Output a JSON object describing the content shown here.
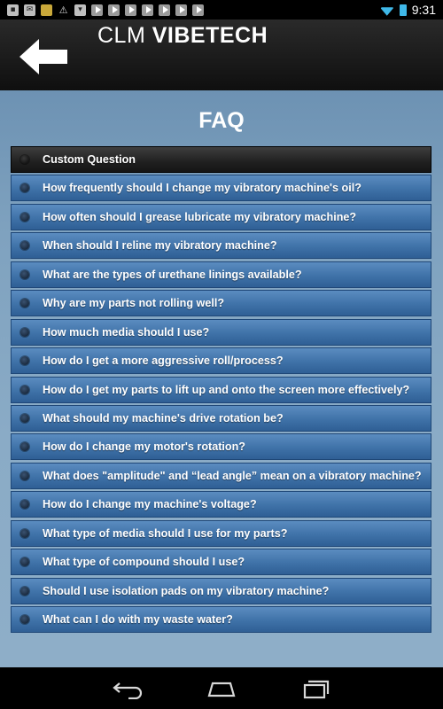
{
  "status_bar": {
    "time": "9:31",
    "icons": [
      "notification-icon",
      "mail-icon",
      "image-icon",
      "warning-icon",
      "download-icon",
      "media-icon",
      "media-icon",
      "media-icon",
      "media-icon",
      "media-icon",
      "media-icon",
      "media-icon"
    ],
    "accent_color": "#3fb8e8"
  },
  "header": {
    "title_prefix": "CLM",
    "title_bold": "VIBETECH",
    "back_icon": "back-arrow-icon"
  },
  "main": {
    "page_title": "FAQ",
    "items": [
      {
        "label": "Custom Question"
      },
      {
        "label": "How frequently should I change my vibratory machine's oil?"
      },
      {
        "label": "How often should I grease lubricate my vibratory machine?"
      },
      {
        "label": "When should I reline my vibratory machine?"
      },
      {
        "label": "What are the types of urethane linings available?"
      },
      {
        "label": "Why are my parts not rolling well?"
      },
      {
        "label": "How much media should I use?"
      },
      {
        "label": "How do I get a more aggressive roll/process?"
      },
      {
        "label": "How do I get my parts to lift up and onto the screen more effectively?"
      },
      {
        "label": "What should my machine's drive rotation be?"
      },
      {
        "label": "How do I change my motor's rotation?"
      },
      {
        "label": "What does \"amplitude\" and “lead angle” mean on a vibratory machine?"
      },
      {
        "label": "How do I change my machine's voltage?"
      },
      {
        "label": "What type of media should I use for my parts?"
      },
      {
        "label": "What type of compound should I use?"
      },
      {
        "label": "Should I use isolation pads on my vibratory machine?"
      },
      {
        "label": "What can I do with my waste water?"
      }
    ],
    "colors": {
      "item_blue": "#3f72a8",
      "custom_item": "#202020",
      "background": "#8aabc6"
    }
  },
  "navbar": {
    "buttons": [
      "back-nav-icon",
      "home-nav-icon",
      "recent-apps-icon"
    ]
  }
}
